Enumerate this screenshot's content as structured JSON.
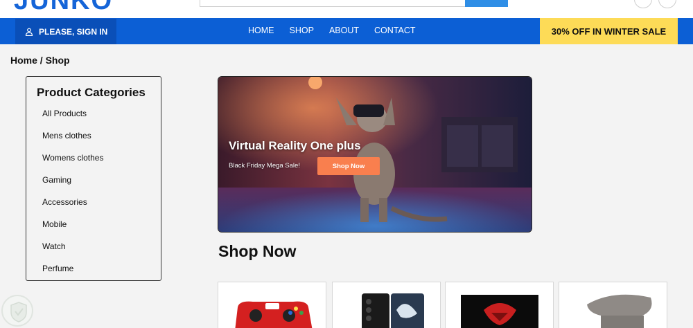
{
  "header": {
    "logo": "JUNKO"
  },
  "nav": {
    "signin_label": "PLEASE, SIGN IN",
    "links": [
      "HOME",
      "SHOP",
      "ABOUT",
      "CONTACT"
    ],
    "promo": "30% OFF IN WINTER SALE"
  },
  "breadcrumb": "Home / Shop",
  "categories": {
    "title": "Product Categories",
    "items": [
      "All Products",
      "Mens clothes",
      "Womens clothes",
      "Gaming",
      "Accessories",
      "Mobile",
      "Watch",
      "Perfume"
    ]
  },
  "hero": {
    "title": "Virtual Reality One plus",
    "subtitle": "Black Friday Mega Sale!",
    "button": "Shop Now"
  },
  "section_title": "Shop Now",
  "products": [
    {
      "icon": "gamepad-icon"
    },
    {
      "icon": "smartphone-icon"
    },
    {
      "icon": "monitor-icon"
    },
    {
      "icon": "chair-icon"
    }
  ],
  "colors": {
    "brand_blue": "#0c5fd5",
    "promo_yellow": "#fddb57",
    "cta_orange": "#f97f4e"
  }
}
